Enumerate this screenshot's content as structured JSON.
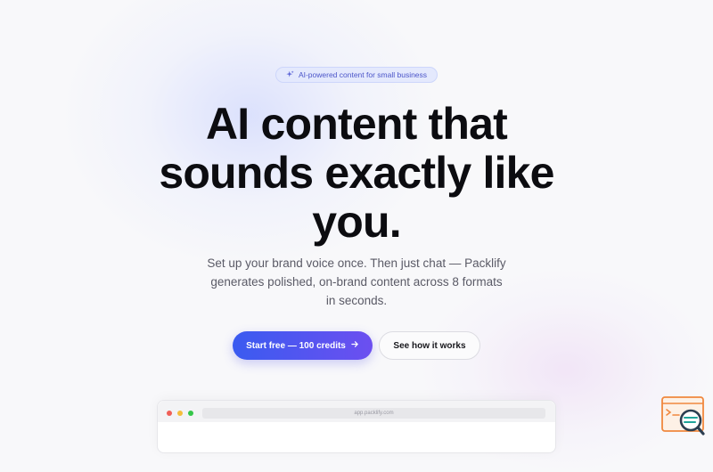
{
  "hero": {
    "badge_icon": "sparkle-icon",
    "badge_text": "AI-powered content for small business",
    "headline_line1": "AI content that",
    "headline_line2": "sounds exactly like",
    "headline_line3": "you.",
    "subtitle": "Set up your brand voice once. Then just chat — Packlify generates polished, on-brand content across 8 formats in seconds.",
    "primary_cta": "Start free — 100 credits",
    "primary_cta_icon": "arrow-right-icon",
    "secondary_cta": "See how it works"
  },
  "preview": {
    "url": "app.packlify.com"
  },
  "widget": {
    "icon": "support-search-icon"
  },
  "colors": {
    "accent_start": "#3a5bf0",
    "accent_end": "#6c4ff0",
    "badge_bg": "#e4e9fd",
    "badge_text": "#4b55c9",
    "headline": "#0c0c10",
    "widget_orange": "#f0883e"
  }
}
